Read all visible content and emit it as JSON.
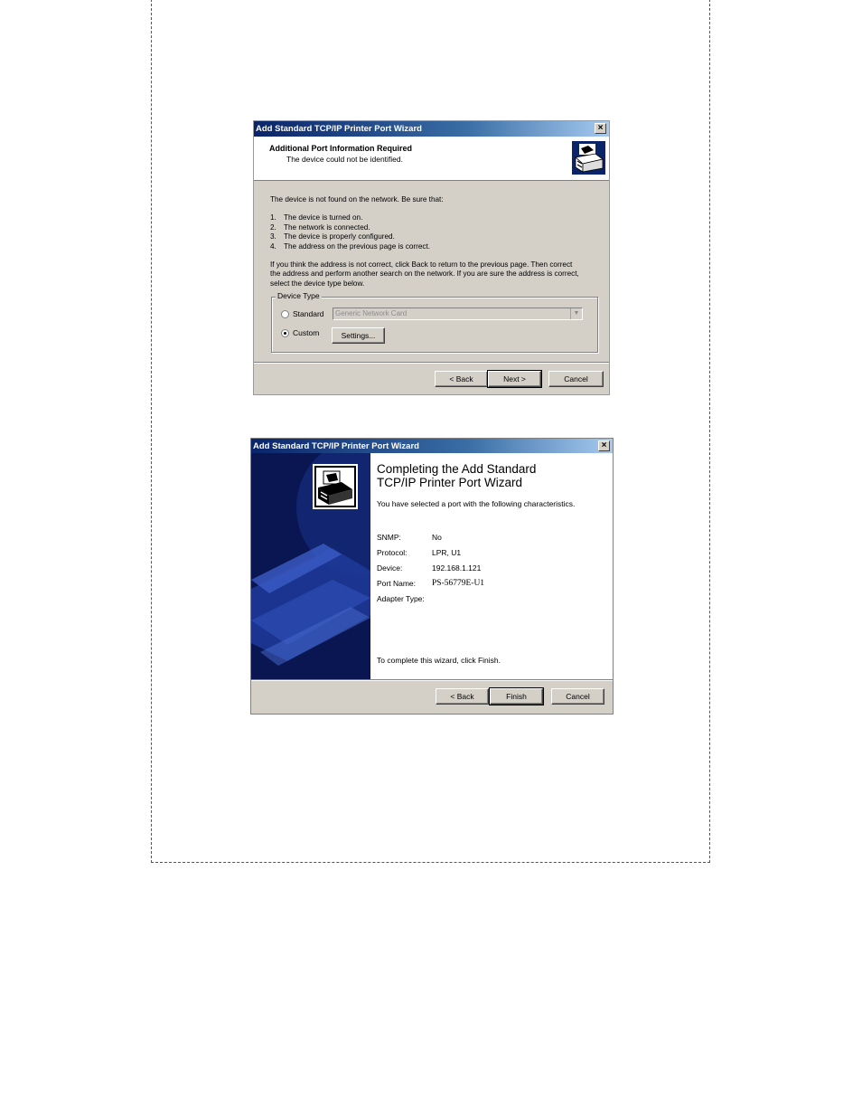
{
  "dialog1": {
    "title": "Add Standard TCP/IP Printer Port Wizard",
    "header_title": "Additional Port Information Required",
    "header_subtitle": "The device could not be identified.",
    "intro": "The device is not found on the network.  Be sure that:",
    "checklist": [
      {
        "num": "1.",
        "text": "The device is turned on."
      },
      {
        "num": "2.",
        "text": "The network is connected."
      },
      {
        "num": "3.",
        "text": "The device is properly configured."
      },
      {
        "num": "4.",
        "text": "The address on the previous page is correct."
      }
    ],
    "advice_line1": "If you think the address is not correct, click Back to return to the previous page.  Then correct",
    "advice_line2": "the address and perform another search on the network.  If you are sure the address is correct,",
    "advice_line3": "select the device type below.",
    "device_type_label": "Device Type",
    "standard_label": "Standard",
    "standard_value": "Generic Network Card",
    "custom_label": "Custom",
    "settings_button": "Settings...",
    "selected_option": "Custom",
    "back_button": "< Back",
    "next_button": "Next >",
    "cancel_button": "Cancel"
  },
  "dialog2": {
    "title": "Add Standard TCP/IP Printer Port Wizard",
    "heading_line1": "Completing the Add Standard",
    "heading_line2": "TCP/IP Printer Port Wizard",
    "subtitle": "You have selected a port with the following characteristics.",
    "properties": [
      {
        "label": "SNMP:",
        "value": "No"
      },
      {
        "label": "Protocol:",
        "value": "LPR, U1"
      },
      {
        "label": "Device:",
        "value": "192.168.1.121"
      },
      {
        "label": "Port Name:",
        "value": "PS-56779E-U1"
      },
      {
        "label": "Adapter Type:",
        "value": ""
      }
    ],
    "footer_text": "To complete this wizard, click Finish.",
    "back_button": "< Back",
    "finish_button": "Finish",
    "cancel_button": "Cancel"
  },
  "colors": {
    "titlebar_start": "#0a246a",
    "titlebar_end": "#a6caf0",
    "dialog_face": "#d4d0c8",
    "sidebar": "#0a1652"
  }
}
